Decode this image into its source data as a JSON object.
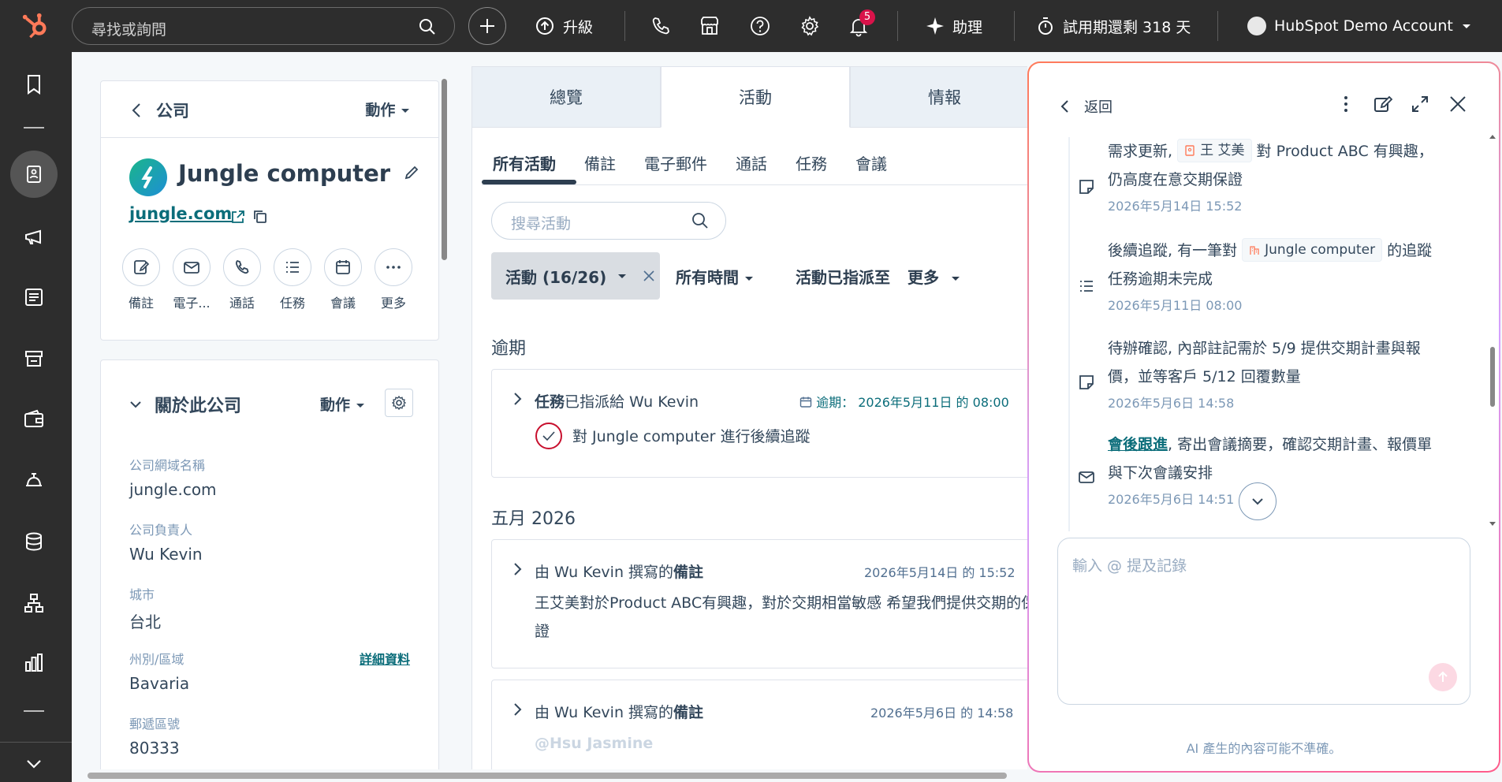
{
  "topbar": {
    "search_placeholder": "尋找或詢問",
    "upgrade_label": "升級",
    "notification_count": "5",
    "assistant_label": "助理",
    "trial_label": "試用期還剩 318 天",
    "account_name": "HubSpot Demo Account",
    "brand_color": "#ff7a59"
  },
  "record": {
    "back_label": "公司",
    "actions_label": "動作",
    "company_name": "Jungle computer",
    "domain": "jungle.com",
    "action_buttons": [
      "備註",
      "電子...",
      "通話",
      "任務",
      "會議",
      "更多"
    ]
  },
  "about": {
    "title": "關於此公司",
    "actions_label": "動作",
    "detail_link": "詳細資料",
    "properties": [
      {
        "label": "公司網域名稱",
        "value": "jungle.com"
      },
      {
        "label": "公司負責人",
        "value": "Wu Kevin"
      },
      {
        "label": "城市",
        "value": "台北"
      },
      {
        "label": "州別/區域",
        "value": "Bavaria"
      },
      {
        "label": "郵遞區號",
        "value": "80333"
      }
    ]
  },
  "main_tabs": [
    "總覽",
    "活動",
    "情報"
  ],
  "activity": {
    "sub_tabs": [
      "所有活動",
      "備註",
      "電子郵件",
      "通話",
      "任務",
      "會議"
    ],
    "search_placeholder": "搜尋活動",
    "filter_chip": "活動 (16/26)",
    "filter_time": "所有時間",
    "filter_assigned": "活動已指派至",
    "filter_more": "更多",
    "section_overdue": "逾期",
    "section_month": "五月 2026",
    "task_card": {
      "type": "任務",
      "assigned_text": "已指派給 Wu Kevin",
      "due_label": "逾期：",
      "due_date": "2026年5月11日 的 08:00",
      "task_title": "對 Jungle computer 進行後續追蹤"
    },
    "note_card_1": {
      "prefix": "由 Wu Kevin 撰寫的",
      "type": "備註",
      "date": "2026年5月14日 的 15:52",
      "body": "王艾美對於Product ABC有興趣，對於交期相當敏感 希望我們提供交期的保證"
    },
    "note_card_2": {
      "prefix": "由 Wu Kevin 撰寫的",
      "type": "備註",
      "date": "2026年5月6日 的 14:58",
      "body": "@Hsu Jasmine"
    }
  },
  "assistant": {
    "back_label": "返回",
    "items": [
      {
        "text_before": "需求更新,",
        "chip": "王 艾美",
        "text_after": "對 Product ABC 有興趣，仍高度在意交期保證",
        "timestamp": "2026年5月14日 15:52"
      },
      {
        "text_before": "後續追蹤, 有一筆對",
        "chip": "Jungle computer",
        "text_after": "的追蹤任務逾期未完成",
        "timestamp": "2026年5月11日 08:00"
      },
      {
        "text": "待辦確認, 內部註記需於 5/9 提供交期計畫與報價，並等客戶 5/12 回覆數量",
        "timestamp": "2026年5月6日 14:58"
      },
      {
        "link": "會後跟進",
        "text": ", 寄出會議摘要，確認交期計畫、報價單與下次會議安排",
        "timestamp": "2026年5月6日 14:51"
      }
    ],
    "input_placeholder": "輸入 @ 提及記錄",
    "disclaimer": "AI 產生的內容可能不準確。"
  }
}
